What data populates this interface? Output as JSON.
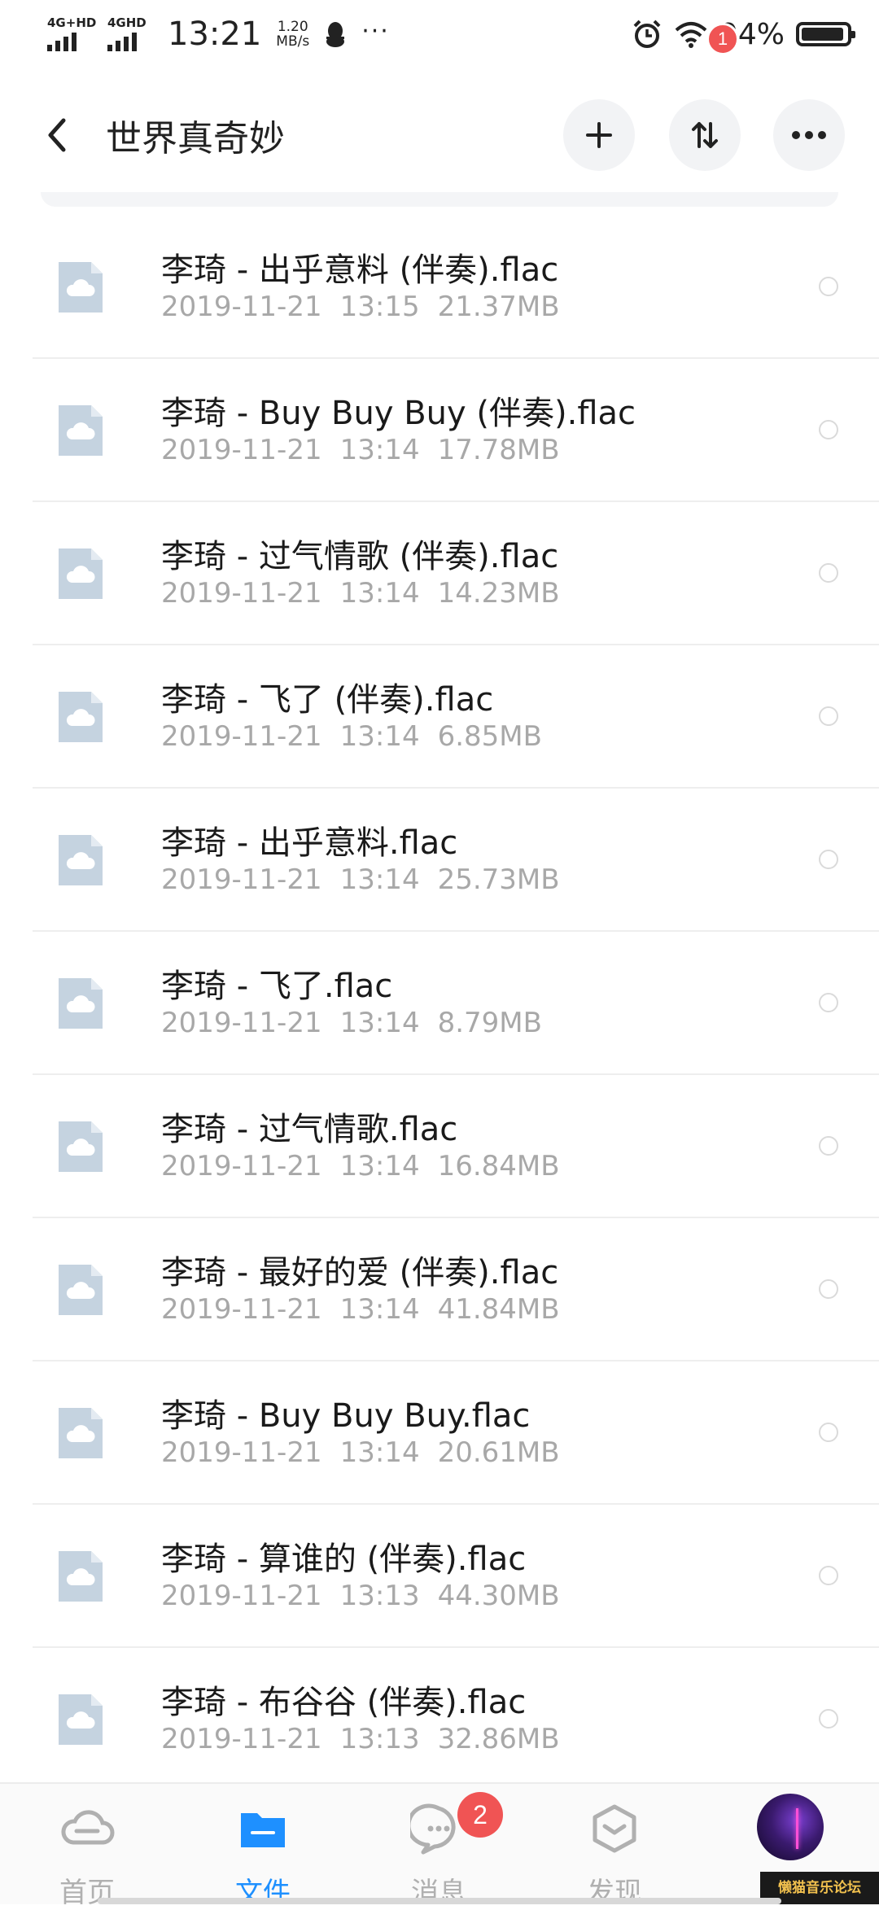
{
  "status_bar": {
    "net1": "4G+HD",
    "net2": "4GHD",
    "time": "13:21",
    "speed_value": "1.20",
    "speed_unit": "MB/s",
    "more": "···",
    "battery_pct": "94%",
    "battery_level": 0.94
  },
  "header": {
    "title": "世界真奇妙",
    "transfer_badge": "1"
  },
  "files": [
    {
      "name": "李琦 - 出乎意料 (伴奏).flac",
      "date": "2019-11-21",
      "time": "13:15",
      "size": "21.37MB"
    },
    {
      "name": "李琦 - Buy Buy Buy (伴奏).flac",
      "date": "2019-11-21",
      "time": "13:14",
      "size": "17.78MB"
    },
    {
      "name": "李琦 - 过气情歌 (伴奏).flac",
      "date": "2019-11-21",
      "time": "13:14",
      "size": "14.23MB"
    },
    {
      "name": "李琦 - 飞了 (伴奏).flac",
      "date": "2019-11-21",
      "time": "13:14",
      "size": "6.85MB"
    },
    {
      "name": "李琦 - 出乎意料.flac",
      "date": "2019-11-21",
      "time": "13:14",
      "size": "25.73MB"
    },
    {
      "name": "李琦 - 飞了.flac",
      "date": "2019-11-21",
      "time": "13:14",
      "size": "8.79MB"
    },
    {
      "name": "李琦 - 过气情歌.flac",
      "date": "2019-11-21",
      "time": "13:14",
      "size": "16.84MB"
    },
    {
      "name": "李琦 - 最好的爱 (伴奏).flac",
      "date": "2019-11-21",
      "time": "13:14",
      "size": "41.84MB"
    },
    {
      "name": "李琦 - Buy Buy Buy.flac",
      "date": "2019-11-21",
      "time": "13:14",
      "size": "20.61MB"
    },
    {
      "name": "李琦 - 算谁的 (伴奏).flac",
      "date": "2019-11-21",
      "time": "13:13",
      "size": "44.30MB"
    },
    {
      "name": "李琦 - 布谷谷 (伴奏).flac",
      "date": "2019-11-21",
      "time": "13:13",
      "size": "32.86MB"
    }
  ],
  "bottom_nav": {
    "home": "首页",
    "files": "文件",
    "messages": "消息",
    "discover": "发现",
    "messages_badge": "2"
  },
  "watermark": "懒猫音乐论坛",
  "colors": {
    "accent": "#1e90ff",
    "badge": "#f05454",
    "file_icon": "#c5d3e0",
    "meta_text": "#a8a8a8"
  }
}
